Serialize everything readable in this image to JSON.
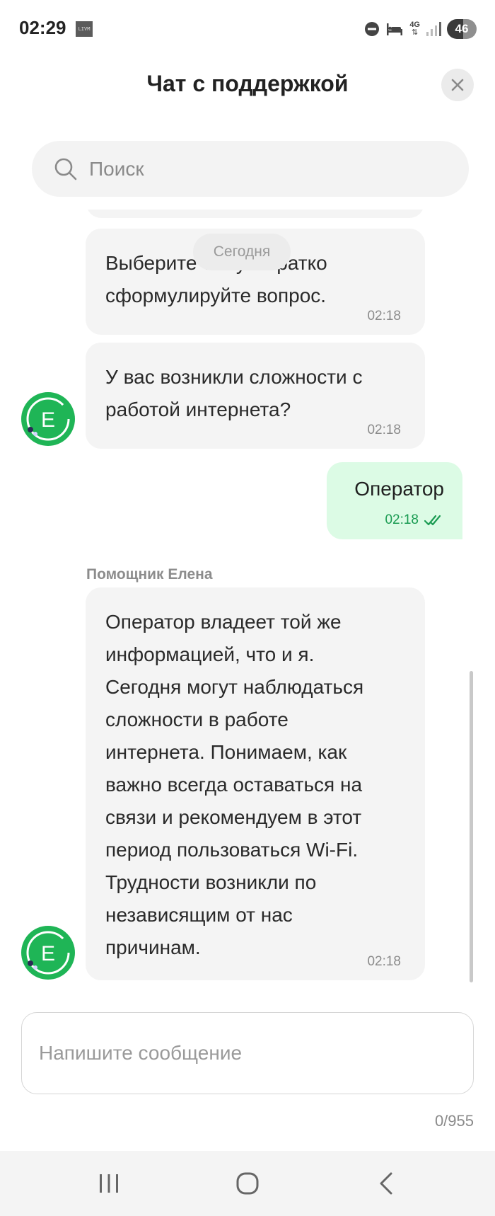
{
  "status_bar": {
    "time": "02:29",
    "app_icon_text": "LIVM",
    "network": "4G",
    "battery": "46"
  },
  "header": {
    "title": "Чат с поддержкой"
  },
  "search": {
    "placeholder": "Поиск"
  },
  "chat": {
    "date_label": "Сегодня",
    "messages": [
      {
        "text_line1": "Выберите тему и кратко",
        "text_line2": "сформулируйте вопрос.",
        "time": "02:18"
      },
      {
        "text_line1": "У вас возникли сложности с",
        "text_line2": "работой интернета?",
        "time": "02:18"
      }
    ],
    "outgoing": {
      "text": "Оператор",
      "time": "02:18"
    },
    "sender_name": "Помощник Елена",
    "long_message": {
      "lines": [
        "Оператор владеет той же",
        "информацией, что и я.",
        "Сегодня могут наблюдаться",
        "сложности в работе",
        "интернета. Понимаем, как",
        "важно всегда оставаться на",
        "связи и рекомендуем в этот",
        "период пользоваться Wi-Fi.",
        "Трудности возникли по",
        "независящим от нас",
        "причинам."
      ],
      "time": "02:18"
    },
    "avatar_letter": "E"
  },
  "composer": {
    "placeholder": "Напишите сообщение",
    "counter": "0/955"
  },
  "icons": {
    "accent_green": "#1fb556",
    "bubble_grey": "#f4f4f4",
    "outgoing_bubble": "#dcfbe5"
  }
}
